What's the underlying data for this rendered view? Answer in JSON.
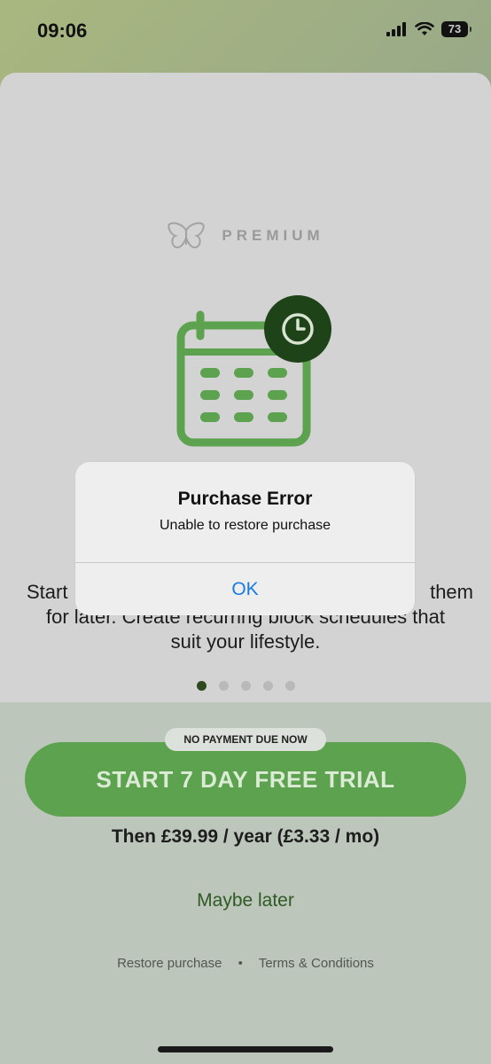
{
  "status_bar": {
    "time": "09:06",
    "battery": "73"
  },
  "header": {
    "premium_label": "PREMIUM"
  },
  "slide": {
    "description_lines": [
      "Start",
      "them",
      "for later. Create recurring block schedules that",
      "suit your lifestyle."
    ]
  },
  "pager": {
    "count": 5,
    "active_index": 0
  },
  "cta": {
    "badge": "NO PAYMENT DUE NOW",
    "trial_button": "START 7 DAY FREE TRIAL",
    "price": "Then £39.99 / year (£3.33 / mo)",
    "maybe_later": "Maybe later"
  },
  "footer": {
    "restore": "Restore purchase",
    "separator": "•",
    "terms": "Terms & Conditions"
  },
  "alert": {
    "title": "Purchase Error",
    "message": "Unable to restore purchase",
    "ok": "OK"
  },
  "colors": {
    "brand_green": "#5ca24f",
    "dark_green": "#2d4a1e",
    "alert_link": "#1a7be0"
  }
}
